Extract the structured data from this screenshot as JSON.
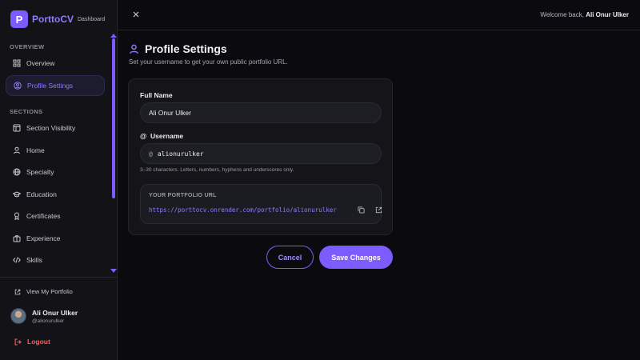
{
  "brand": {
    "name": "PorttoCV",
    "subtitle": "Dashboard",
    "logo_letter": "P"
  },
  "sidebar": {
    "overview_label": "OVERVIEW",
    "sections_label": "SECTIONS",
    "overview_items": [
      {
        "label": "Overview",
        "icon": "grid-icon"
      },
      {
        "label": "Profile Settings",
        "icon": "user-circle-icon",
        "active": true
      }
    ],
    "section_items": [
      {
        "label": "Section Visibility",
        "icon": "layout-icon"
      },
      {
        "label": "Home",
        "icon": "user-icon"
      },
      {
        "label": "Specialty",
        "icon": "globe-icon"
      },
      {
        "label": "Education",
        "icon": "graduation-cap-icon"
      },
      {
        "label": "Certificates",
        "icon": "award-icon"
      },
      {
        "label": "Experience",
        "icon": "briefcase-icon"
      },
      {
        "label": "Skills",
        "icon": "code-icon"
      }
    ],
    "view_portfolio": "View My Portfolio",
    "user": {
      "name": "Ali Onur Ulker",
      "handle": "@alionurulker"
    },
    "logout": "Logout"
  },
  "topbar": {
    "welcome_prefix": "Welcome back,",
    "welcome_name": "Ali Onur Ulker"
  },
  "main": {
    "title": "Profile Settings",
    "subtitle": "Set your username to get your own public portfolio URL.",
    "full_name_label": "Full Name",
    "full_name_value": "Ali Onur Ulker",
    "username_label_prefix": "@",
    "username_label": "Username",
    "username_prefix": "@",
    "username_value": "alionurulker",
    "username_hint": "3–30 characters. Letters, numbers, hyphens and underscores only.",
    "portfolio_url_label": "YOUR PORTFOLIO URL",
    "portfolio_url": "https://porttocv.onrender.com/portfolio/alionurulker",
    "cancel_label": "Cancel",
    "save_label": "Save Changes"
  },
  "colors": {
    "accent": "#7c5cff",
    "danger": "#ff5a5a",
    "background": "#0b0b0f",
    "sidebar": "#121217"
  }
}
